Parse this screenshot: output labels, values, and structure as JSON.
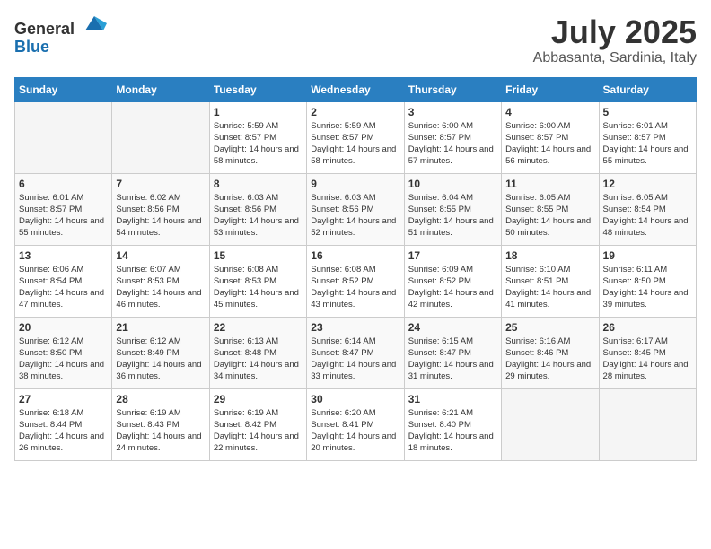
{
  "header": {
    "logo_general": "General",
    "logo_blue": "Blue",
    "month_title": "July 2025",
    "subtitle": "Abbasanta, Sardinia, Italy"
  },
  "days_of_week": [
    "Sunday",
    "Monday",
    "Tuesday",
    "Wednesday",
    "Thursday",
    "Friday",
    "Saturday"
  ],
  "weeks": [
    [
      {
        "day": "",
        "sunrise": "",
        "sunset": "",
        "daylight": ""
      },
      {
        "day": "",
        "sunrise": "",
        "sunset": "",
        "daylight": ""
      },
      {
        "day": "1",
        "sunrise": "Sunrise: 5:59 AM",
        "sunset": "Sunset: 8:57 PM",
        "daylight": "Daylight: 14 hours and 58 minutes."
      },
      {
        "day": "2",
        "sunrise": "Sunrise: 5:59 AM",
        "sunset": "Sunset: 8:57 PM",
        "daylight": "Daylight: 14 hours and 58 minutes."
      },
      {
        "day": "3",
        "sunrise": "Sunrise: 6:00 AM",
        "sunset": "Sunset: 8:57 PM",
        "daylight": "Daylight: 14 hours and 57 minutes."
      },
      {
        "day": "4",
        "sunrise": "Sunrise: 6:00 AM",
        "sunset": "Sunset: 8:57 PM",
        "daylight": "Daylight: 14 hours and 56 minutes."
      },
      {
        "day": "5",
        "sunrise": "Sunrise: 6:01 AM",
        "sunset": "Sunset: 8:57 PM",
        "daylight": "Daylight: 14 hours and 55 minutes."
      }
    ],
    [
      {
        "day": "6",
        "sunrise": "Sunrise: 6:01 AM",
        "sunset": "Sunset: 8:57 PM",
        "daylight": "Daylight: 14 hours and 55 minutes."
      },
      {
        "day": "7",
        "sunrise": "Sunrise: 6:02 AM",
        "sunset": "Sunset: 8:56 PM",
        "daylight": "Daylight: 14 hours and 54 minutes."
      },
      {
        "day": "8",
        "sunrise": "Sunrise: 6:03 AM",
        "sunset": "Sunset: 8:56 PM",
        "daylight": "Daylight: 14 hours and 53 minutes."
      },
      {
        "day": "9",
        "sunrise": "Sunrise: 6:03 AM",
        "sunset": "Sunset: 8:56 PM",
        "daylight": "Daylight: 14 hours and 52 minutes."
      },
      {
        "day": "10",
        "sunrise": "Sunrise: 6:04 AM",
        "sunset": "Sunset: 8:55 PM",
        "daylight": "Daylight: 14 hours and 51 minutes."
      },
      {
        "day": "11",
        "sunrise": "Sunrise: 6:05 AM",
        "sunset": "Sunset: 8:55 PM",
        "daylight": "Daylight: 14 hours and 50 minutes."
      },
      {
        "day": "12",
        "sunrise": "Sunrise: 6:05 AM",
        "sunset": "Sunset: 8:54 PM",
        "daylight": "Daylight: 14 hours and 48 minutes."
      }
    ],
    [
      {
        "day": "13",
        "sunrise": "Sunrise: 6:06 AM",
        "sunset": "Sunset: 8:54 PM",
        "daylight": "Daylight: 14 hours and 47 minutes."
      },
      {
        "day": "14",
        "sunrise": "Sunrise: 6:07 AM",
        "sunset": "Sunset: 8:53 PM",
        "daylight": "Daylight: 14 hours and 46 minutes."
      },
      {
        "day": "15",
        "sunrise": "Sunrise: 6:08 AM",
        "sunset": "Sunset: 8:53 PM",
        "daylight": "Daylight: 14 hours and 45 minutes."
      },
      {
        "day": "16",
        "sunrise": "Sunrise: 6:08 AM",
        "sunset": "Sunset: 8:52 PM",
        "daylight": "Daylight: 14 hours and 43 minutes."
      },
      {
        "day": "17",
        "sunrise": "Sunrise: 6:09 AM",
        "sunset": "Sunset: 8:52 PM",
        "daylight": "Daylight: 14 hours and 42 minutes."
      },
      {
        "day": "18",
        "sunrise": "Sunrise: 6:10 AM",
        "sunset": "Sunset: 8:51 PM",
        "daylight": "Daylight: 14 hours and 41 minutes."
      },
      {
        "day": "19",
        "sunrise": "Sunrise: 6:11 AM",
        "sunset": "Sunset: 8:50 PM",
        "daylight": "Daylight: 14 hours and 39 minutes."
      }
    ],
    [
      {
        "day": "20",
        "sunrise": "Sunrise: 6:12 AM",
        "sunset": "Sunset: 8:50 PM",
        "daylight": "Daylight: 14 hours and 38 minutes."
      },
      {
        "day": "21",
        "sunrise": "Sunrise: 6:12 AM",
        "sunset": "Sunset: 8:49 PM",
        "daylight": "Daylight: 14 hours and 36 minutes."
      },
      {
        "day": "22",
        "sunrise": "Sunrise: 6:13 AM",
        "sunset": "Sunset: 8:48 PM",
        "daylight": "Daylight: 14 hours and 34 minutes."
      },
      {
        "day": "23",
        "sunrise": "Sunrise: 6:14 AM",
        "sunset": "Sunset: 8:47 PM",
        "daylight": "Daylight: 14 hours and 33 minutes."
      },
      {
        "day": "24",
        "sunrise": "Sunrise: 6:15 AM",
        "sunset": "Sunset: 8:47 PM",
        "daylight": "Daylight: 14 hours and 31 minutes."
      },
      {
        "day": "25",
        "sunrise": "Sunrise: 6:16 AM",
        "sunset": "Sunset: 8:46 PM",
        "daylight": "Daylight: 14 hours and 29 minutes."
      },
      {
        "day": "26",
        "sunrise": "Sunrise: 6:17 AM",
        "sunset": "Sunset: 8:45 PM",
        "daylight": "Daylight: 14 hours and 28 minutes."
      }
    ],
    [
      {
        "day": "27",
        "sunrise": "Sunrise: 6:18 AM",
        "sunset": "Sunset: 8:44 PM",
        "daylight": "Daylight: 14 hours and 26 minutes."
      },
      {
        "day": "28",
        "sunrise": "Sunrise: 6:19 AM",
        "sunset": "Sunset: 8:43 PM",
        "daylight": "Daylight: 14 hours and 24 minutes."
      },
      {
        "day": "29",
        "sunrise": "Sunrise: 6:19 AM",
        "sunset": "Sunset: 8:42 PM",
        "daylight": "Daylight: 14 hours and 22 minutes."
      },
      {
        "day": "30",
        "sunrise": "Sunrise: 6:20 AM",
        "sunset": "Sunset: 8:41 PM",
        "daylight": "Daylight: 14 hours and 20 minutes."
      },
      {
        "day": "31",
        "sunrise": "Sunrise: 6:21 AM",
        "sunset": "Sunset: 8:40 PM",
        "daylight": "Daylight: 14 hours and 18 minutes."
      },
      {
        "day": "",
        "sunrise": "",
        "sunset": "",
        "daylight": ""
      },
      {
        "day": "",
        "sunrise": "",
        "sunset": "",
        "daylight": ""
      }
    ]
  ]
}
